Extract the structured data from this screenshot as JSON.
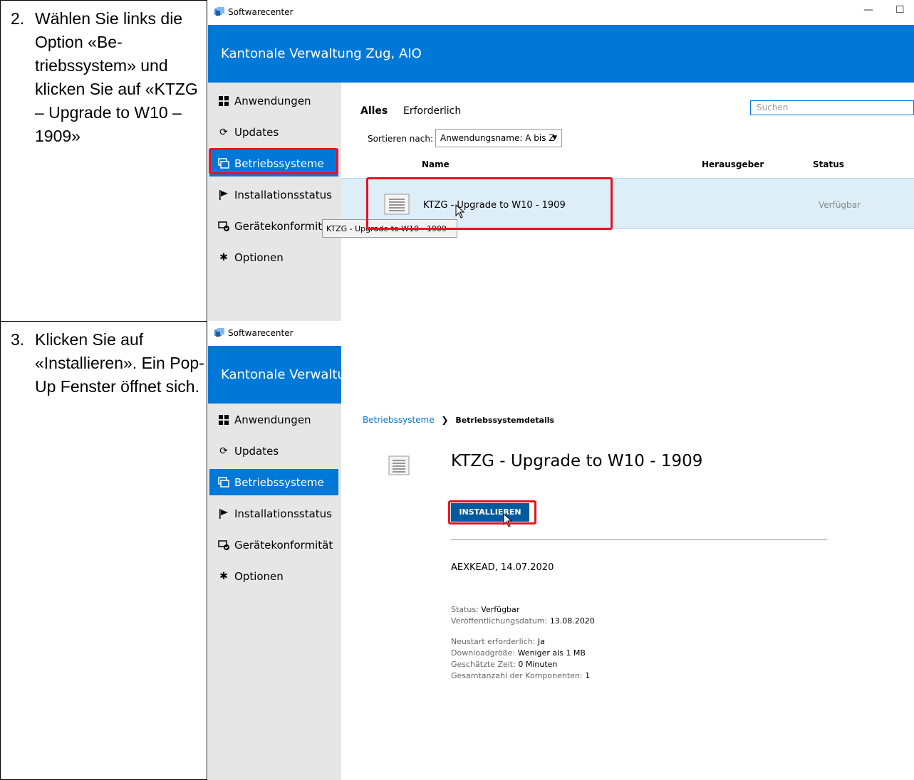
{
  "steps": [
    {
      "number": "2.",
      "text": "Wählen Sie links die Option «Be-triebssystem» und klicken Sie auf «KTZG – Upgrade to W10 – 1909»"
    },
    {
      "number": "3.",
      "text": "Klicken Sie auf «Installieren». Ein Pop-Up Fenster öffnet sich."
    }
  ],
  "window": {
    "title": "Softwarecenter",
    "minimize_glyph": "—",
    "maximize_glyph": "☐",
    "organization": "Kantonale Verwaltung Zug, AIO"
  },
  "nav": [
    {
      "label": "Anwendungen",
      "icon": "grid-icon"
    },
    {
      "label": "Updates",
      "icon": "refresh-icon"
    },
    {
      "label": "Betriebssysteme",
      "icon": "windows-stack-icon"
    },
    {
      "label": "Installationsstatus",
      "icon": "flag-icon"
    },
    {
      "label": "Gerätekonformität",
      "icon": "device-check-icon"
    },
    {
      "label": "Optionen",
      "icon": "gear-icon"
    }
  ],
  "list_view": {
    "tabs": [
      "Alles",
      "Erforderlich"
    ],
    "search_placeholder": "Suchen",
    "sort_label": "Sortieren nach:",
    "sort_value": "Anwendungsname: A bis Z",
    "columns": [
      "Name",
      "Herausgeber",
      "Status"
    ],
    "rows": [
      {
        "name": "KTZG - Upgrade to W10 - 1909",
        "publisher": "",
        "status": "Verfügbar"
      }
    ],
    "tooltip": "KTZG - Upgrade to W10 - 1909"
  },
  "detail_view": {
    "breadcrumb_link": "Betriebssysteme",
    "breadcrumb_sep": "❯",
    "breadcrumb_current": "Betriebssystemdetails",
    "title": "KTZG - Upgrade to W10 - 1909",
    "install_label": "INSTALLIEREN",
    "publisher_date": "AEXKEAD, 14.07.2020",
    "status_label": "Status:",
    "status_value": "Verfügbar",
    "published_label": "Veröffentlichungsdatum:",
    "published_value": "13.08.2020",
    "restart_label": "Neustart erforderlich:",
    "restart_value": "Ja",
    "download_label": "Downloadgröße:",
    "download_value": "Weniger als 1 MB",
    "time_label": "Geschätzte Zeit:",
    "time_value": "0 Minuten",
    "components_label": "Gesamtanzahl der Komponenten:",
    "components_value": "1"
  },
  "colors": {
    "accent": "#0078d7",
    "highlight": "#e81123",
    "sidebar": "#e6e6e6"
  }
}
